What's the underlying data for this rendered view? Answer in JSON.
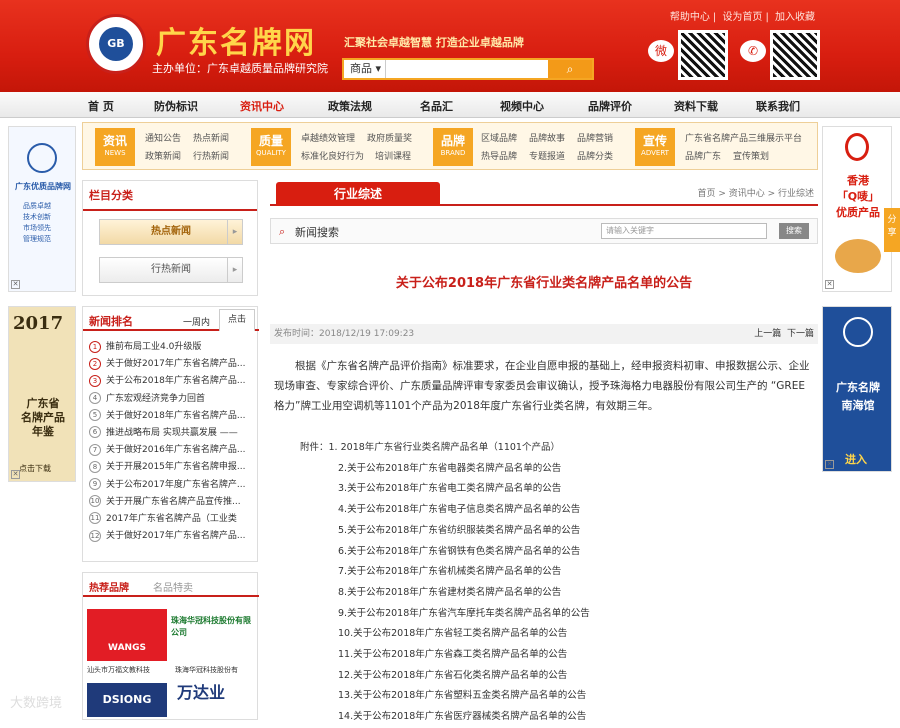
{
  "header": {
    "site_title": "广东名牌网",
    "logo_text": "GB",
    "subtitle": "主办单位：广东卓越质量品牌研究院",
    "slogan": "汇聚社会卓越智慧    打造企业卓越品牌",
    "top_links": [
      "帮助中心",
      "设为首页",
      "加入收藏"
    ],
    "search": {
      "category": "商品",
      "button_icon": "search-icon"
    }
  },
  "nav": {
    "items": [
      "首 页",
      "防伪标识",
      "资讯中心",
      "政策法规",
      "名品汇",
      "视频中心",
      "品牌评价",
      "资料下载",
      "联系我们"
    ],
    "active": "资讯中心"
  },
  "subnav": {
    "groups": [
      {
        "label": "资讯",
        "en": "NEWS",
        "links": [
          "通知公告",
          "热点新闻",
          "政策新闻",
          "行热新闻"
        ]
      },
      {
        "label": "质量",
        "en": "QUALITY",
        "links": [
          "卓越绩效管理",
          "政府质量奖",
          "标准化良好行为",
          "培训课程"
        ]
      },
      {
        "label": "品牌",
        "en": "BRAND",
        "links": [
          "区域品牌",
          "品牌故事",
          "品牌营销",
          "热导品牌",
          "专题报道",
          "品牌分类"
        ]
      },
      {
        "label": "宣传",
        "en": "ADVERT",
        "links": [
          "广东省名牌产品三维展示平台",
          "品牌广东",
          "宣传策划"
        ]
      }
    ]
  },
  "left_ads": {
    "top": {
      "title": "广东优质品牌网",
      "lines": [
        "品质卓越",
        "技术创新",
        "市场领先",
        "管理规范"
      ]
    },
    "bottom": {
      "year": "2017",
      "lines": [
        "广东省",
        "名牌产品",
        "年鉴"
      ],
      "cta": "点击下载"
    }
  },
  "right_ads": {
    "top": {
      "lines": [
        "香港",
        "「Q唛」",
        "优质产品"
      ]
    },
    "bottom": {
      "lines": [
        "广东名牌",
        "南海馆"
      ],
      "cta": "进入"
    },
    "share": "分享"
  },
  "category_panel": {
    "title": "栏目分类",
    "items": [
      {
        "label": "热点新闻",
        "active": true
      },
      {
        "label": "行热新闻",
        "active": false
      }
    ]
  },
  "news_rank": {
    "title": "新闻排名",
    "tabs": [
      "一周内",
      "点击"
    ],
    "items": [
      "推前布局工业4.0升级版",
      "关于做好2017年广东省名牌产品...",
      "关于公布2018年广东省名牌产品...",
      "广东宏观经济竞争力回首",
      "关于做好2018年广东省名牌产品...",
      "推进战略布局 实现共赢发展 ——",
      "关于做好2016年广东省名牌产品...",
      "关于开展2015年广东省名牌申报...",
      "关于公布2017年度广东省名牌产...",
      "关于开展广东省名牌产品宣传推...",
      "2017年广东省名牌产品（工业类",
      "关于做好2017年广东省名牌产品..."
    ]
  },
  "brand_panel": {
    "tabs": [
      "热荐品牌",
      "名品特卖"
    ],
    "brands": [
      {
        "logo": "WANGS",
        "name": "汕头市万福文教科技"
      },
      {
        "logo": "珠海华冠科技股份有限公司",
        "name": "珠海华冠科技股份有"
      },
      {
        "logo": "DSIONG",
        "name": ""
      },
      {
        "logo": "万达业",
        "name": ""
      }
    ]
  },
  "article": {
    "section_tab": "行业综述",
    "breadcrumb": "首页 > 资讯中心 > 行业综述",
    "search_label": "新闻搜索",
    "search_placeholder": "请输入关键字",
    "search_button": "搜索",
    "title": "关于公布2018年广东省行业类名牌产品名单的公告",
    "published": "发布时间：2018/12/19 17:09:23",
    "prev": "上一篇",
    "next": "下一篇",
    "body": "根据《广东省名牌产品评价指南》标准要求，在企业自愿申报的基础上，经申报资料初审、申报数据公示、企业现场审查、专家综合评价、广东质量品牌评审专家委员会审议确认，授予珠海格力电器股份有限公司生产的 “GREE格力”牌工业用空调机等1101个产品为2018年度广东省行业类名牌，有效期三年。",
    "attachments_label": "附件：",
    "attachments": [
      "1. 2018年广东省行业类名牌产品名单（1101个产品）",
      "2.关于公布2018年广东省电器类名牌产品名单的公告",
      "3.关于公布2018年广东省电工类名牌产品名单的公告",
      "4.关于公布2018年广东省电子信息类名牌产品名单的公告",
      "5.关于公布2018年广东省纺织服装类名牌产品名单的公告",
      "6.关于公布2018年广东省钢铁有色类名牌产品名单的公告",
      "7.关于公布2018年广东省机械类名牌产品名单的公告",
      "8.关于公布2018年广东省建材类名牌产品名单的公告",
      "9.关于公布2018年广东省汽车摩托车类名牌产品名单的公告",
      "10.关于公布2018年广东省轻工类名牌产品名单的公告",
      "11.关于公布2018年广东省森工类名牌产品名单的公告",
      "12.关于公布2018年广东省石化类名牌产品名单的公告",
      "13.关于公布2018年广东省塑料五金类名牌产品名单的公告",
      "14.关于公布2018年广东省医疗器械类名牌产品名单的公告"
    ]
  },
  "watermark": "大数跨境",
  "colors": {
    "brand_red": "#d81e10",
    "accent_orange": "#f5a623",
    "link_red": "#c8201a"
  }
}
